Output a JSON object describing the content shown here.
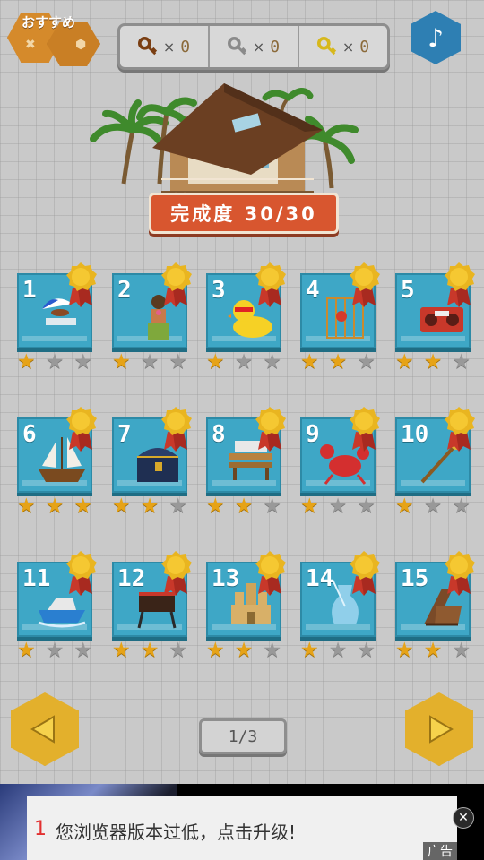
{
  "top_bar": {
    "recommend_label": "おすすめ",
    "keys": [
      {
        "icon": "bronze-key-icon",
        "color": "#7a3e12",
        "x_label": "×",
        "count": "0"
      },
      {
        "icon": "silver-key-icon",
        "color": "#8a8a8a",
        "x_label": "×",
        "count": "0"
      },
      {
        "icon": "gold-key-icon",
        "color": "#d7b81c",
        "x_label": "×",
        "count": "0"
      }
    ],
    "music_icon": "♪"
  },
  "hero": {
    "progress_text": "完成度 30/30"
  },
  "levels": [
    {
      "number": "1",
      "stars": 1,
      "item": "beach-umbrella-and-chair"
    },
    {
      "number": "2",
      "stars": 1,
      "item": "hula-dancer"
    },
    {
      "number": "3",
      "stars": 1,
      "item": "rubber-duck-with-sunglasses"
    },
    {
      "number": "4",
      "stars": 2,
      "item": "parrot-cage"
    },
    {
      "number": "5",
      "stars": 2,
      "item": "red-radio"
    },
    {
      "number": "6",
      "stars": 3,
      "item": "sailing-ship"
    },
    {
      "number": "7",
      "stars": 2,
      "item": "treasure-chest"
    },
    {
      "number": "8",
      "stars": 2,
      "item": "bench"
    },
    {
      "number": "9",
      "stars": 1,
      "item": "red-crab"
    },
    {
      "number": "10",
      "stars": 1,
      "item": "scepter"
    },
    {
      "number": "11",
      "stars": 1,
      "item": "speedboat"
    },
    {
      "number": "12",
      "stars": 2,
      "item": "bbq-grill"
    },
    {
      "number": "13",
      "stars": 2,
      "item": "sand-castle"
    },
    {
      "number": "14",
      "stars": 1,
      "item": "glass-vase"
    },
    {
      "number": "15",
      "stars": 2,
      "item": "deck-chair"
    }
  ],
  "pagination": {
    "text": "1/3"
  },
  "ad": {
    "num": "1",
    "text": "您浏览器版本过低，点击升级!",
    "close": "✕",
    "label": "广告"
  },
  "colors": {
    "tile": "#3ea7c6",
    "star_on": "#e6a317",
    "star_off": "#999999",
    "banner": "#d8562f",
    "nav": "#e3b02c"
  }
}
